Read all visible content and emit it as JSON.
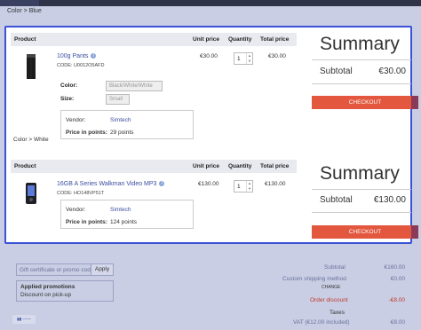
{
  "breadcrumb": "Color > Blue",
  "table_headers": {
    "product": "Product",
    "unit_price": "Unit price",
    "quantity": "Quantity",
    "total_price": "Total price"
  },
  "items": [
    {
      "name": "100g Pants",
      "code": "CODE: U0012O5AFD",
      "unit_price": "€30.00",
      "quantity": "1",
      "total_price": "€30.00",
      "options": [
        {
          "label": "Color:",
          "value": "Black/White/White"
        },
        {
          "label": "Size:",
          "value": "Small"
        }
      ],
      "vendor_label": "Vendor:",
      "vendor": "Simtech",
      "points_label": "Price in points:",
      "points": "29 points"
    },
    {
      "name": "16GB A Series Walkman Video MP3",
      "code": "CODE: HO148VP51T",
      "unit_price": "€130.00",
      "quantity": "1",
      "total_price": "€130.00",
      "vendor_label": "Vendor:",
      "vendor": "Simtech",
      "points_label": "Price in points:",
      "points": "124 points"
    }
  ],
  "color_caption": "Color > White",
  "summaries": [
    {
      "title": "Summary",
      "subtotal_label": "Subtotal",
      "subtotal": "€30.00",
      "checkout": "CHECKOUT"
    },
    {
      "title": "Summary",
      "subtotal_label": "Subtotal",
      "subtotal": "€130.00",
      "checkout": "CHECKOUT"
    }
  ],
  "bottom": {
    "gift_placeholder": "Gift certificate or promo code",
    "apply": "Apply",
    "promo_title": "Applied promotions",
    "promo_desc": "Discount on pick-up",
    "totals": [
      {
        "label": "Subtotal",
        "value": "€160.00"
      },
      {
        "label": "Custom shipping method",
        "value": "€0.00"
      },
      {
        "label": "CHANGE",
        "value": ""
      },
      {
        "label": "Order discount",
        "value": "-€8.00"
      },
      {
        "label": "Taxes",
        "value": ""
      },
      {
        "label": "VAT (€12.00 included)",
        "value": "€8.00"
      }
    ]
  },
  "colors": {
    "accent": "#3b52d4",
    "checkout": "#e2573e",
    "overlay": "#c9cee4"
  }
}
